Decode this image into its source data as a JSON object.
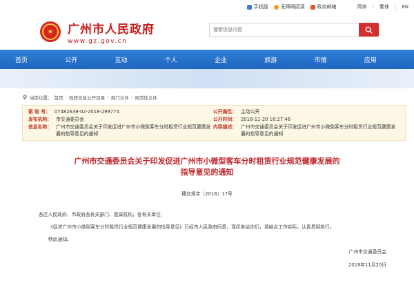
{
  "topbar": {
    "mobile": "手机版",
    "accessible": "无障碍阅读",
    "gov_weibo": "政务邮箱",
    "lang_simplified": "简体",
    "lang_traditional": "繁体",
    "lang_en": "EN",
    "colors": {
      "mobile": "#3b7dd8",
      "accessible": "#f0a020",
      "gov_weibo": "#e35a2b"
    }
  },
  "header": {
    "site_name": "广州市人民政府",
    "site_domain": "www.gz.gov.cn",
    "emblem_icon": "government-emblem",
    "search_placeholder": "搜索信息内容",
    "search_icon": "search-icon"
  },
  "nav": {
    "items": [
      {
        "label": "首页"
      },
      {
        "label": "公开"
      },
      {
        "label": "互动"
      },
      {
        "label": "个人"
      },
      {
        "label": "企业"
      },
      {
        "label": "旅游"
      },
      {
        "label": "市情"
      },
      {
        "label": "应用"
      }
    ],
    "color": "#2470c8"
  },
  "breadcrumb": {
    "prefix": "当前位置：",
    "items": [
      "首页",
      "政府信息公开目录",
      "部门文件",
      "规范性文件"
    ]
  },
  "meta": {
    "index_label": "索 取 号：",
    "index_value": "07482639-02-2018-299774",
    "category_label": "公开属性：",
    "category_value": "主动公开",
    "publisher_label": "发布机构：",
    "publisher_value": "市交通委员会",
    "date_label": "公开时间：",
    "date_value": "2018-11-20 16:27:46",
    "name_label": "信息名称：",
    "name_value": "广州市交通委员会关于印发促进广州市小微型客车分时租赁行业规范健康发展的指导意见的通知",
    "desc_label": "内容描述：",
    "desc_value": "广州市交通委员会关于印发促进广州市小微型客车分时租赁行业规范健康发展的指导意见的通知"
  },
  "document": {
    "title_line1": "广州市交通委员会关于印发促进广州市小微型客车分时租赁行业规范健康发展的",
    "title_line2": "指导意见的通知",
    "number": "穗交规字〔2018〕17号",
    "salutation": "各区人民政府，市政府各有关部门、直属机构，各有关单位：",
    "para1": "《促进广州市小微型客车分时租赁行业规范健康发展的指导意见》已经市人民政府同意，现印发给你们，请结合工作实际，认真贯彻执行。",
    "para2": "特此通知。",
    "signer": "广州市交通委员会",
    "sign_date": "2018年11月20日"
  }
}
